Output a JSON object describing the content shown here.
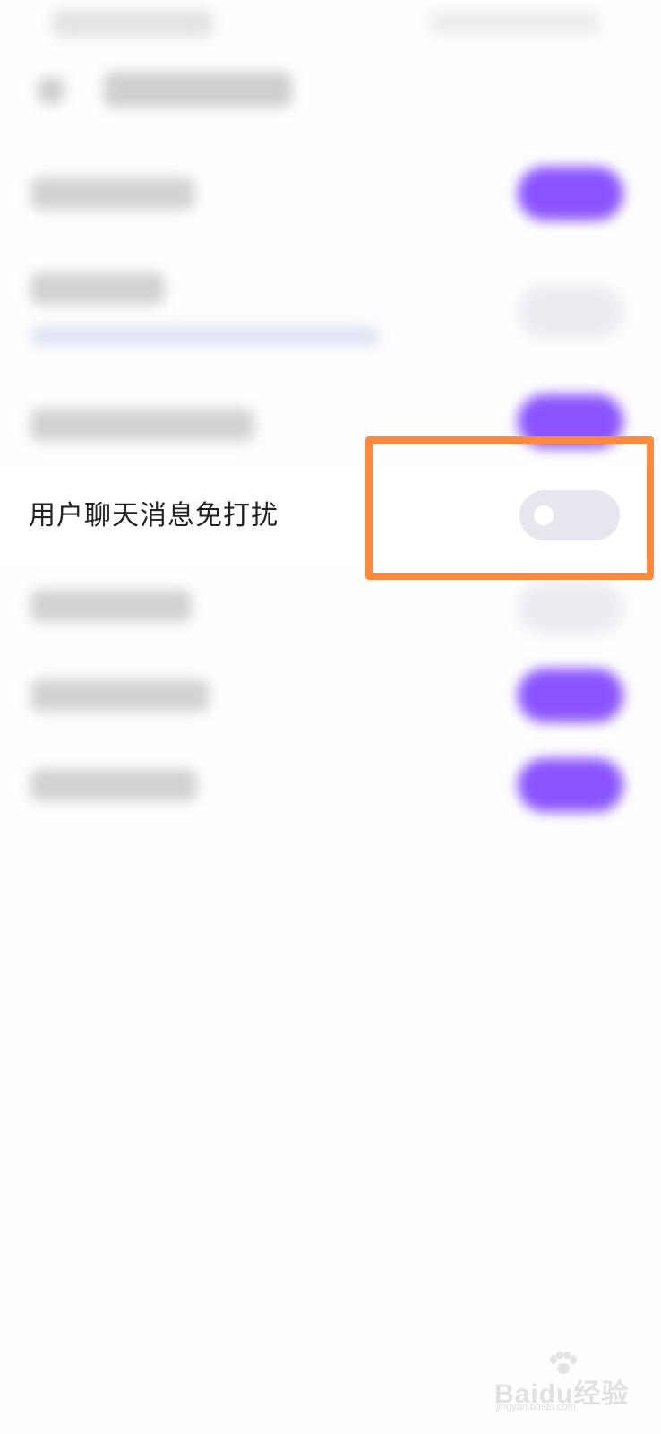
{
  "settings_row": {
    "label": "用户聊天消息免打扰",
    "toggle_state": "off"
  },
  "obscured_rows": [
    {
      "name": "row-1",
      "toggle_state": "on"
    },
    {
      "name": "row-2",
      "toggle_state": "off"
    },
    {
      "name": "row-3",
      "toggle_state": "on"
    },
    {
      "name": "row-5",
      "toggle_state": "off"
    },
    {
      "name": "row-6",
      "toggle_state": "on"
    },
    {
      "name": "row-7",
      "toggle_state": "on"
    }
  ],
  "colors": {
    "toggle_on": "#8a53ff",
    "toggle_off": "#e6e7ef",
    "highlight": "#ff8a3d"
  },
  "watermark": {
    "logo_text": "Baidu经验",
    "url": "jingyan.baidu.com"
  }
}
